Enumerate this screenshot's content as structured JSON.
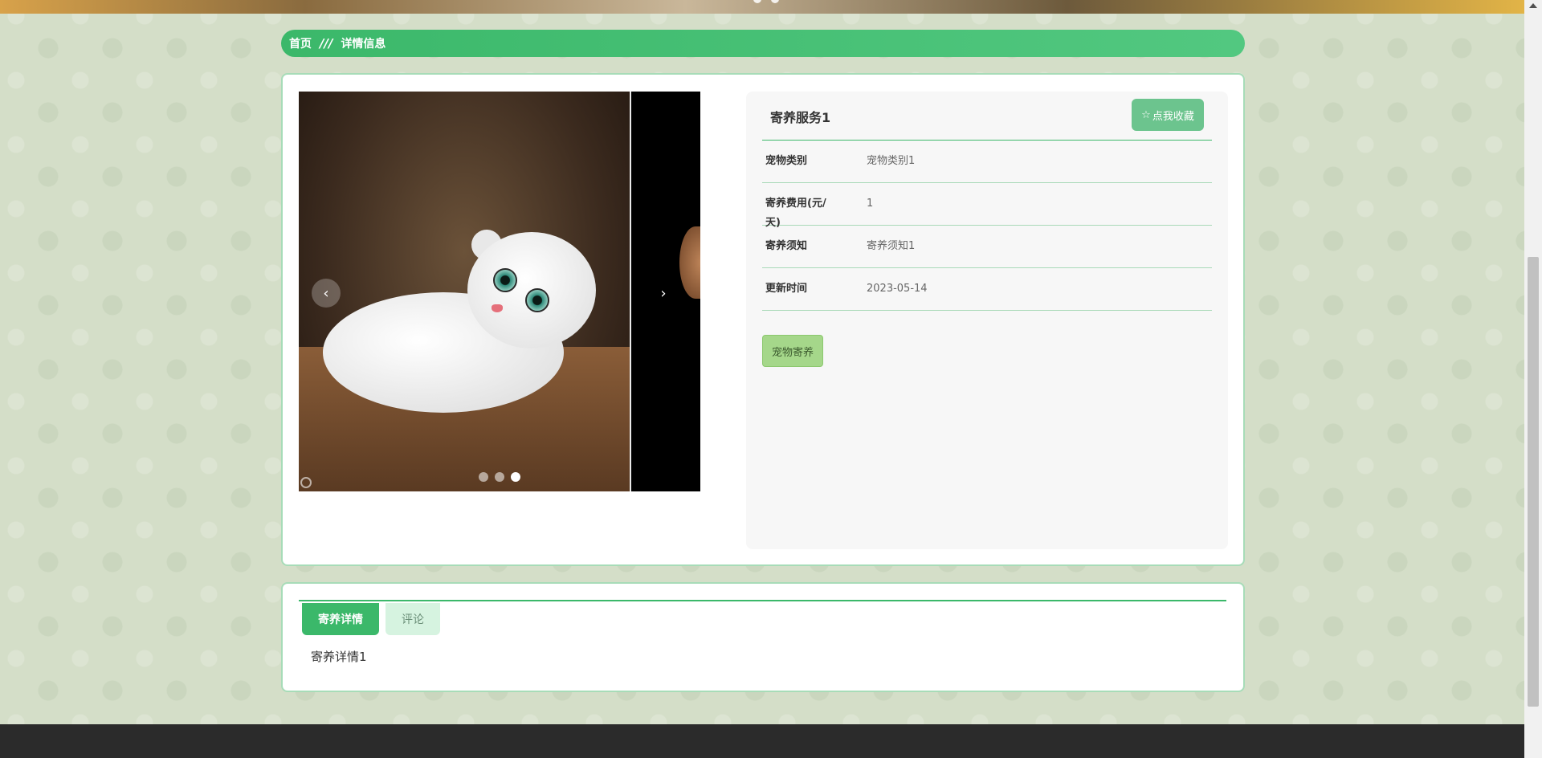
{
  "breadcrumb": {
    "home": "首页",
    "separator": "///",
    "current": "详情信息"
  },
  "carousel": {
    "prev_icon": "‹",
    "next_icon": "›",
    "slides": 3,
    "active_slide": 3
  },
  "detail": {
    "title": "寄养服务1",
    "favorite_button": "点我收藏",
    "favorite_icon": "☆",
    "fields": [
      {
        "label": "宠物类别",
        "value": "宠物类别1"
      },
      {
        "label": "寄养费用(元/天)",
        "value": "1"
      },
      {
        "label": "寄养须知",
        "value": "寄养须知1"
      },
      {
        "label": "更新时间",
        "value": "2023-05-14"
      }
    ],
    "action_button": "宠物寄养"
  },
  "tabs": [
    {
      "label": "寄养详情",
      "active": true
    },
    {
      "label": "评论",
      "active": false
    }
  ],
  "tab_content": "寄养详情1",
  "colors": {
    "primary": "#3bb86a",
    "panel_bg": "#f7f7f7",
    "footer": "#2b2b2b"
  }
}
